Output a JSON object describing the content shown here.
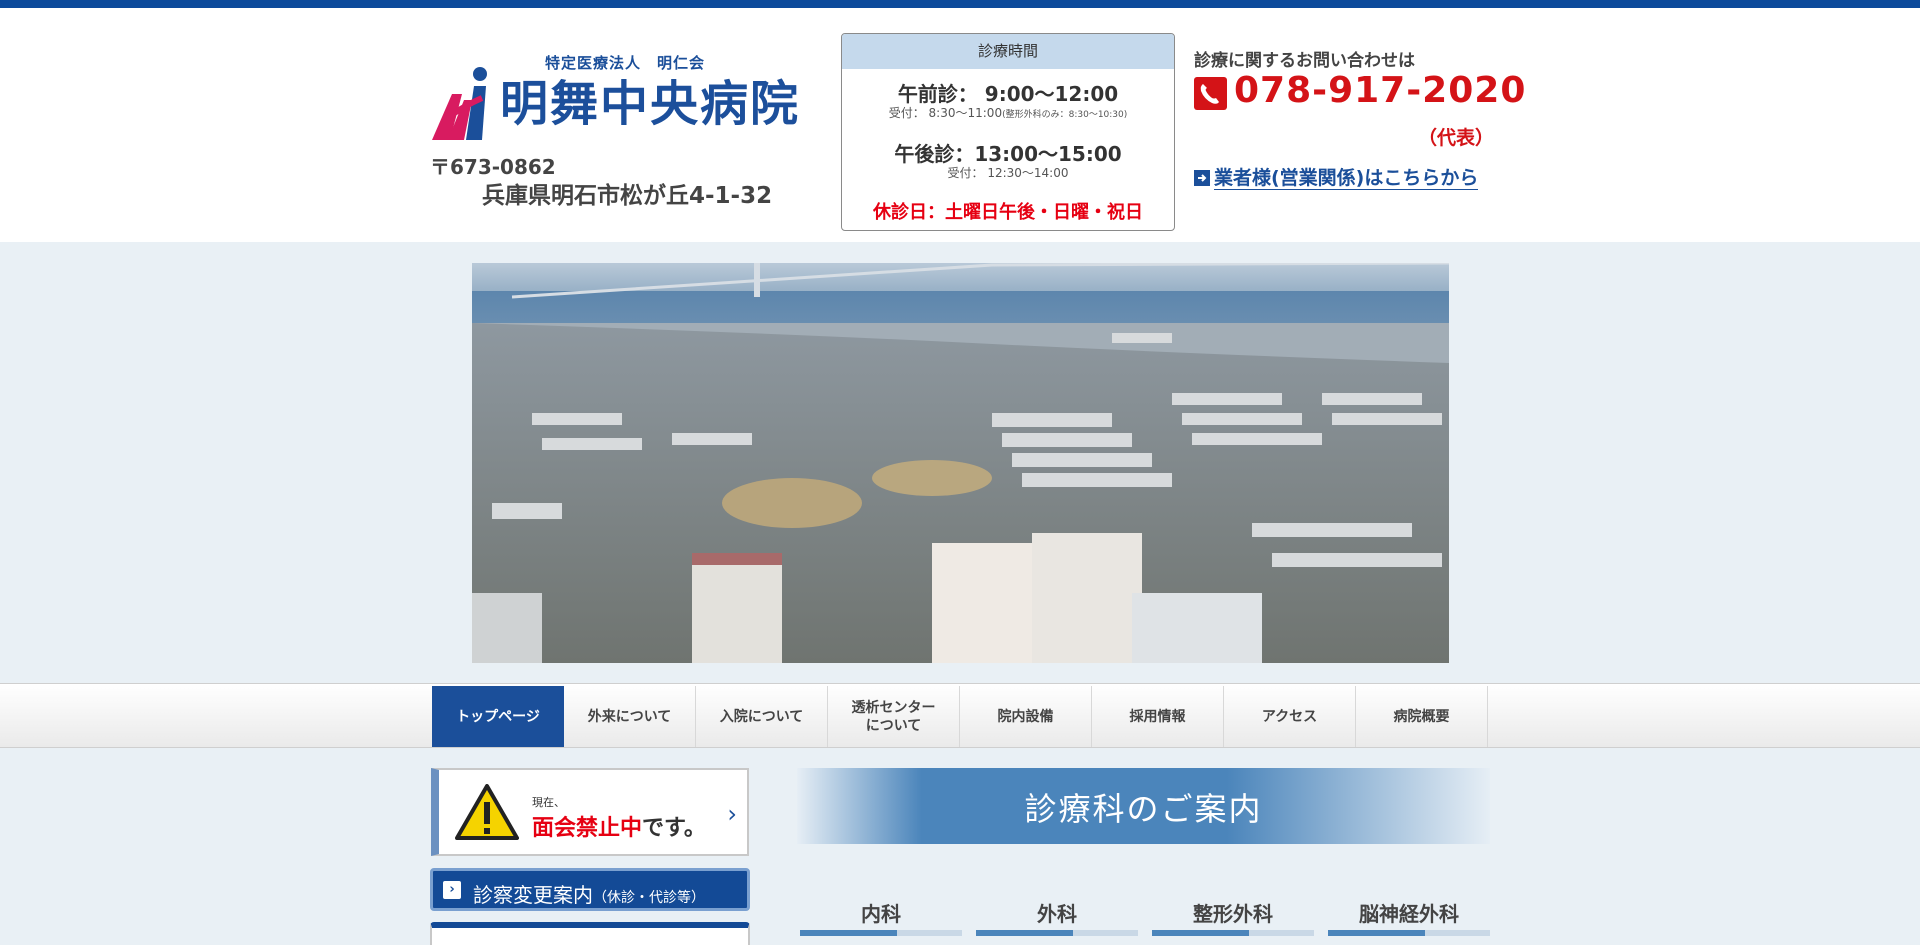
{
  "header": {
    "corp_name": "特定医療法人　明仁会",
    "hospital_name": "明舞中央病院",
    "postal": "〒673-0862",
    "address": "兵庫県明石市松が丘4-1-32"
  },
  "hours": {
    "title": "診療時間",
    "am": "午前診：  9:00～12:00",
    "am_reception": "受付：  8:30～11:00",
    "am_note": "(整形外科のみ：8:30～10:30)",
    "pm": "午後診：13:00～15:00",
    "pm_reception": "受付：  12:30～14:00",
    "closed": "休診日：土曜日午後・日曜・祝日"
  },
  "contact": {
    "label": "診療に関するお問い合わせは",
    "phone": "078-917-2020",
    "rep": "（代表）",
    "vendor_link": "業者様(営業関係)はこちらから"
  },
  "nav": {
    "items": [
      {
        "label": "トップページ"
      },
      {
        "label": "外来について"
      },
      {
        "label": "入院について"
      },
      {
        "label": "透析センター\nについて"
      },
      {
        "label": "院内設備"
      },
      {
        "label": "採用情報"
      },
      {
        "label": "アクセス"
      },
      {
        "label": "病院概要"
      }
    ]
  },
  "notice": {
    "small": "現在、",
    "emphasis": "面会禁止中",
    "suffix": "です。"
  },
  "change_button": {
    "label": "診察変更案内",
    "note": "（休診・代診等）"
  },
  "departments": {
    "title": "診療科のご案内",
    "tabs": [
      "内科",
      "外科",
      "整形外科",
      "脳神経外科"
    ]
  },
  "colors": {
    "brand_blue": "#1b4f9a",
    "alert_red": "#e60012",
    "phone_red": "#d41317",
    "hours_header": "#c5d9ec"
  }
}
